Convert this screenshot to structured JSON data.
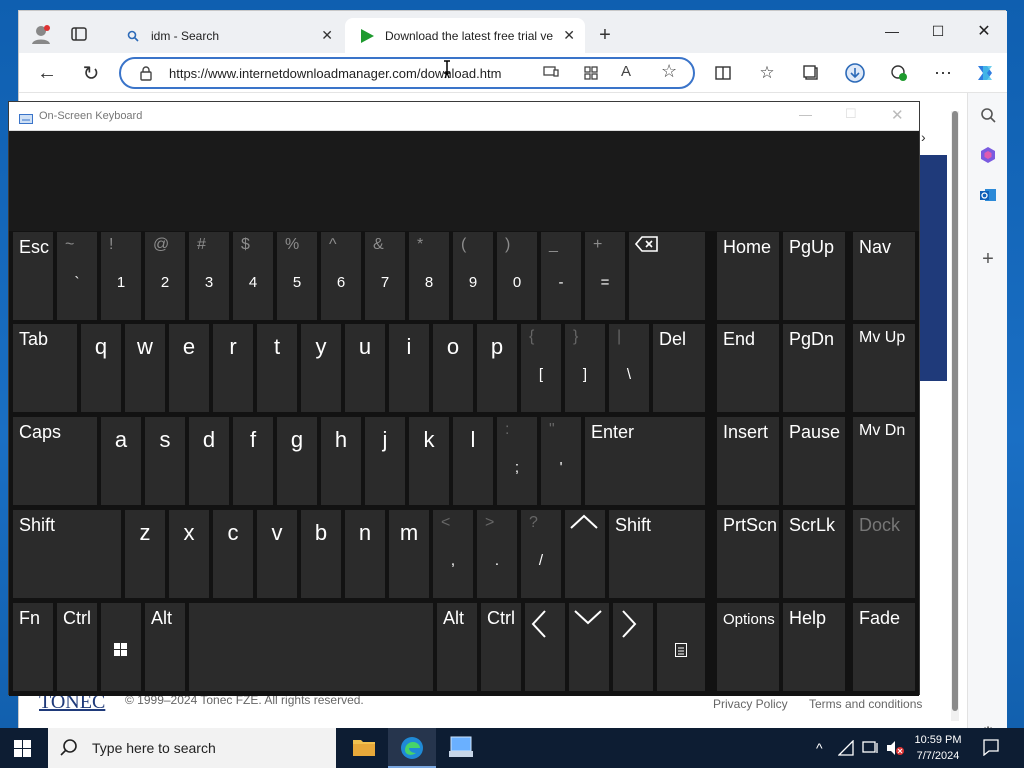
{
  "browser": {
    "tabs": [
      {
        "label": "idm - Search"
      },
      {
        "label": "Download the latest free trial ve"
      }
    ],
    "url": "https://www.internetdownloadmanager.com/download.htm",
    "footer": {
      "copyright": "© 1999–2024 Tonec FZE. All rights reserved.",
      "brand": "TONEC",
      "links": [
        "Privacy Policy",
        "Terms and conditions"
      ]
    }
  },
  "osk": {
    "title": "On-Screen Keyboard",
    "rows": {
      "row1": [
        {
          "main": "Esc"
        },
        {
          "upper": "~",
          "lower": "`"
        },
        {
          "upper": "!",
          "lower": "1"
        },
        {
          "upper": "@",
          "lower": "2"
        },
        {
          "upper": "#",
          "lower": "3"
        },
        {
          "upper": "$",
          "lower": "4"
        },
        {
          "upper": "%",
          "lower": "5"
        },
        {
          "upper": "^",
          "lower": "6"
        },
        {
          "upper": "&",
          "lower": "7"
        },
        {
          "upper": "*",
          "lower": "8"
        },
        {
          "upper": "(",
          "lower": "9"
        },
        {
          "upper": ")",
          "lower": "0"
        },
        {
          "upper": "_",
          "lower": "-"
        },
        {
          "upper": "+",
          "lower": "="
        },
        {
          "main": ""
        },
        {
          "main": "Home"
        },
        {
          "main": "PgUp"
        },
        {
          "main": "Nav"
        }
      ],
      "row2": [
        {
          "main": "Tab"
        },
        {
          "letter": "q"
        },
        {
          "letter": "w"
        },
        {
          "letter": "e"
        },
        {
          "letter": "r"
        },
        {
          "letter": "t"
        },
        {
          "letter": "y"
        },
        {
          "letter": "u"
        },
        {
          "letter": "i"
        },
        {
          "letter": "o"
        },
        {
          "letter": "p"
        },
        {
          "upper": "{",
          "lower": "["
        },
        {
          "upper": "}",
          "lower": "]"
        },
        {
          "upper": "|",
          "lower": "\\"
        },
        {
          "main": "Del"
        },
        {
          "main": "End"
        },
        {
          "main": "PgDn"
        },
        {
          "main": "Mv Up"
        }
      ],
      "row3": [
        {
          "main": "Caps"
        },
        {
          "letter": "a"
        },
        {
          "letter": "s"
        },
        {
          "letter": "d"
        },
        {
          "letter": "f"
        },
        {
          "letter": "g"
        },
        {
          "letter": "h"
        },
        {
          "letter": "j"
        },
        {
          "letter": "k"
        },
        {
          "letter": "l"
        },
        {
          "upper": ":",
          "lower": ";"
        },
        {
          "upper": "\"",
          "lower": "'"
        },
        {
          "main": "Enter"
        },
        {
          "main": "Insert"
        },
        {
          "main": "Pause"
        },
        {
          "main": "Mv Dn"
        }
      ],
      "row4": [
        {
          "main": "Shift"
        },
        {
          "letter": "z"
        },
        {
          "letter": "x"
        },
        {
          "letter": "c"
        },
        {
          "letter": "v"
        },
        {
          "letter": "b"
        },
        {
          "letter": "n"
        },
        {
          "letter": "m"
        },
        {
          "upper": "<",
          "lower": ","
        },
        {
          "upper": ">",
          "lower": "."
        },
        {
          "upper": "?",
          "lower": "/"
        },
        {
          "main": ""
        },
        {
          "main": "Shift"
        },
        {
          "main": "PrtScn"
        },
        {
          "main": "ScrLk"
        },
        {
          "main": "Dock"
        }
      ],
      "row5": [
        {
          "main": "Fn"
        },
        {
          "main": "Ctrl"
        },
        {
          "main": ""
        },
        {
          "main": "Alt"
        },
        {
          "main": ""
        },
        {
          "main": "Alt"
        },
        {
          "main": "Ctrl"
        },
        {
          "main": ""
        },
        {
          "main": ""
        },
        {
          "main": ""
        },
        {
          "main": ""
        },
        {
          "main": "Options"
        },
        {
          "main": "Help"
        },
        {
          "main": "Fade"
        }
      ]
    }
  },
  "taskbar": {
    "search_placeholder": "Type here to search",
    "time": "10:59 PM",
    "date": "7/7/2024"
  },
  "colors": {
    "accent": "#3a74c9",
    "osk_key": "#2b2b2b",
    "taskbar": "#0d1d33"
  }
}
